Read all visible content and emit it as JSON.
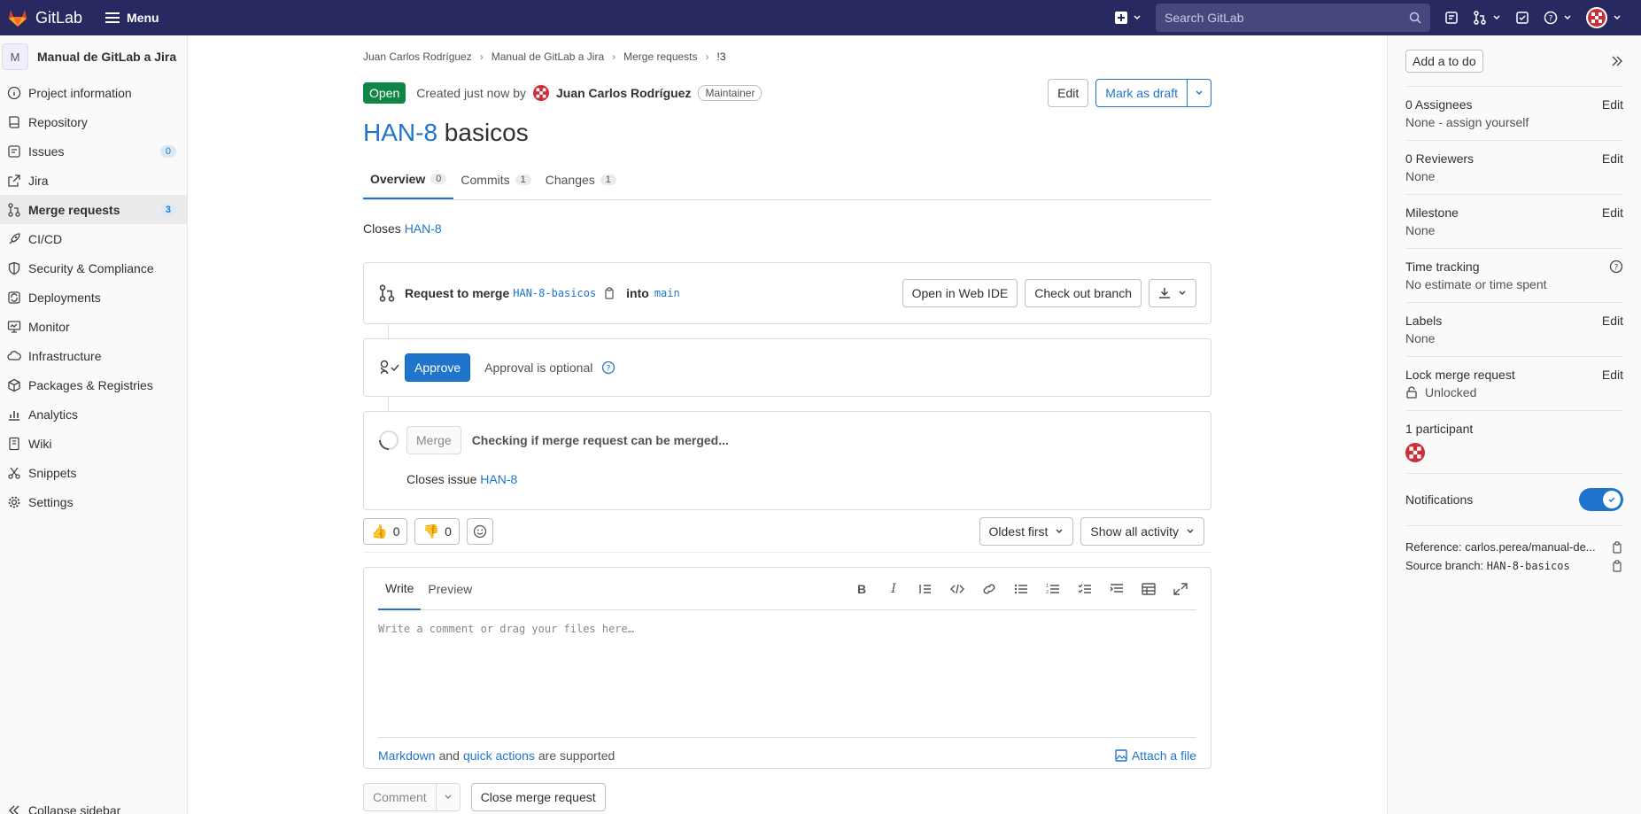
{
  "topbar": {
    "brand": "GitLab",
    "menu_label": "Menu",
    "search_placeholder": "Search GitLab"
  },
  "sidebar": {
    "project_initial": "M",
    "project_name": "Manual de GitLab a Jira",
    "items": [
      {
        "label": "Project information",
        "icon": "info-icon"
      },
      {
        "label": "Repository",
        "icon": "book-icon"
      },
      {
        "label": "Issues",
        "icon": "issues-icon",
        "count": "0"
      },
      {
        "label": "Jira",
        "icon": "external-link-icon"
      },
      {
        "label": "Merge requests",
        "icon": "merge-request-icon",
        "count": "3",
        "active": true
      },
      {
        "label": "CI/CD",
        "icon": "rocket-icon"
      },
      {
        "label": "Security & Compliance",
        "icon": "shield-icon"
      },
      {
        "label": "Deployments",
        "icon": "deployments-icon"
      },
      {
        "label": "Monitor",
        "icon": "monitor-icon"
      },
      {
        "label": "Infrastructure",
        "icon": "cloud-icon"
      },
      {
        "label": "Packages & Registries",
        "icon": "package-icon"
      },
      {
        "label": "Analytics",
        "icon": "chart-icon"
      },
      {
        "label": "Wiki",
        "icon": "wiki-icon"
      },
      {
        "label": "Snippets",
        "icon": "snippet-icon"
      },
      {
        "label": "Settings",
        "icon": "gear-icon"
      }
    ],
    "collapse_label": "Collapse sidebar"
  },
  "breadcrumb": [
    "Juan Carlos Rodríguez",
    "Manual de GitLab a Jira",
    "Merge requests",
    "!3"
  ],
  "mr": {
    "status": "Open",
    "created_text": "Created just now by",
    "author": "Juan Carlos Rodríguez",
    "role": "Maintainer",
    "edit_label": "Edit",
    "draft_label": "Mark as draft",
    "title_ref": "HAN-8",
    "title_text": "basicos",
    "tabs": [
      {
        "label": "Overview",
        "count": "0"
      },
      {
        "label": "Commits",
        "count": "1"
      },
      {
        "label": "Changes",
        "count": "1"
      }
    ],
    "closes_text": "Closes",
    "closes_ref": "HAN-8"
  },
  "merge_widget": {
    "request_label": "Request to merge",
    "source_branch": "HAN-8-basicos",
    "into_label": "into",
    "target_branch": "main",
    "web_ide_label": "Open in Web IDE",
    "checkout_label": "Check out branch",
    "approve_label": "Approve",
    "approval_text": "Approval is optional",
    "merge_label": "Merge",
    "checking_text": "Checking if merge request can be merged...",
    "closes_issue_text": "Closes issue",
    "closes_issue_ref": "HAN-8"
  },
  "reactions": {
    "thumbs_up": "0",
    "thumbs_down": "0",
    "sort_label": "Oldest first",
    "filter_label": "Show all activity"
  },
  "editor": {
    "write_tab": "Write",
    "preview_tab": "Preview",
    "placeholder": "Write a comment or drag your files here…",
    "markdown_link": "Markdown",
    "and_text": "and",
    "quick_actions_link": "quick actions",
    "supported_text": "are supported",
    "attach_label": "Attach a file",
    "comment_label": "Comment",
    "close_mr_label": "Close merge request"
  },
  "right_sidebar": {
    "todo_label": "Add a to do",
    "assignees_label": "0 Assignees",
    "assignees_value": "None - assign yourself",
    "reviewers_label": "0 Reviewers",
    "reviewers_value": "None",
    "milestone_label": "Milestone",
    "milestone_value": "None",
    "time_label": "Time tracking",
    "time_value": "No estimate or time spent",
    "labels_label": "Labels",
    "labels_value": "None",
    "lock_label": "Lock merge request",
    "lock_value": "Unlocked",
    "participants_label": "1 participant",
    "notifications_label": "Notifications",
    "notifications_on": true,
    "reference_label": "Reference:",
    "reference_value": "carlos.perea/manual-de...",
    "source_branch_label": "Source branch:",
    "source_branch_value": "HAN-8-basicos",
    "edit_label": "Edit"
  },
  "colors": {
    "topbar": "#292961",
    "link": "#1f75cb",
    "open_badge": "#108548"
  }
}
